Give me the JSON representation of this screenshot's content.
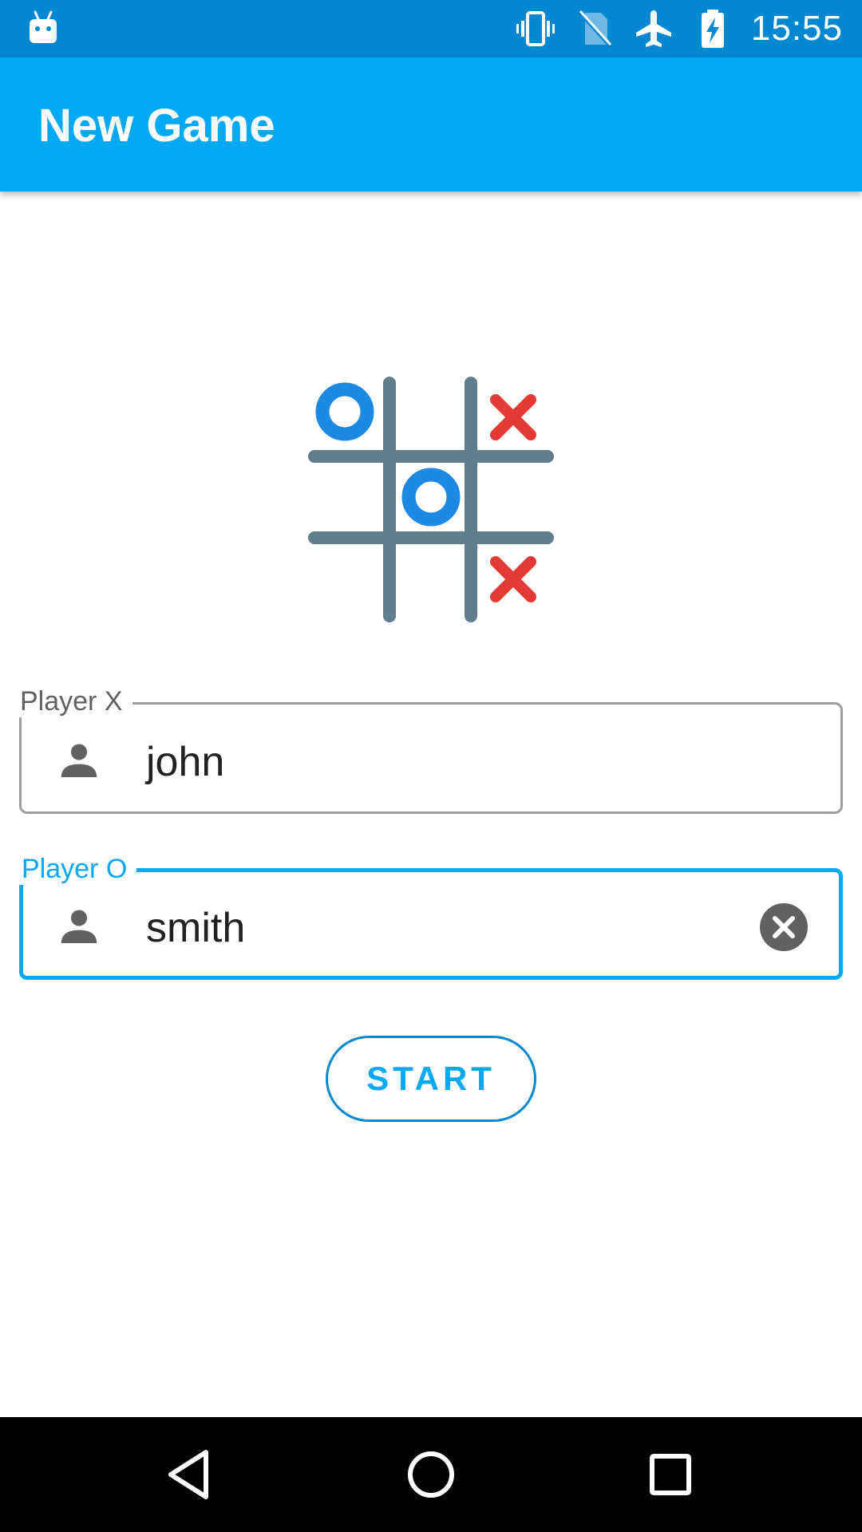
{
  "status_bar": {
    "time": "15:55",
    "icons": [
      "android-icon",
      "vibrate-icon",
      "no-sim-icon",
      "airplane-mode-icon",
      "battery-charging-icon"
    ],
    "color": "#0288D1"
  },
  "app_bar": {
    "title": "New Game",
    "color": "#03A9F4"
  },
  "logo": {
    "icon": "tic-tac-toe-logo-icon",
    "grid_color": "#607D8B",
    "o_color": "#1E88E5",
    "x_color": "#E53935"
  },
  "form": {
    "player_x": {
      "label": "Player X",
      "value": "john",
      "icon": "person-icon"
    },
    "player_o": {
      "label": "Player O",
      "value": "smith",
      "icon": "person-icon",
      "clear_icon": "clear-icon",
      "focused": true
    },
    "accent_color": "#03A9F4"
  },
  "actions": {
    "start_label": "START"
  },
  "nav_bar": {
    "buttons": [
      "back-icon",
      "home-icon",
      "recents-icon"
    ]
  }
}
